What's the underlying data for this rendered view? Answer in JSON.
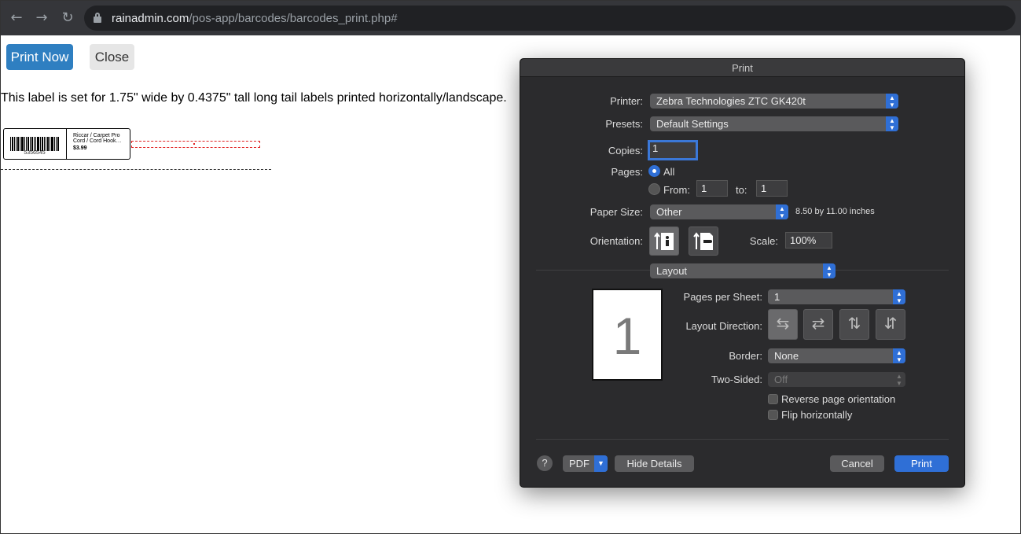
{
  "browser": {
    "back_glyph": "←",
    "forward_glyph": "→",
    "reload_glyph": "↻",
    "url_host": "rainadmin.com",
    "url_path": "/pos-app/barcodes/barcodes_print.php#"
  },
  "page": {
    "print_now_label": "Print Now",
    "close_label": "Close",
    "note": "This label is set for 1.75\" wide by 0.4375\" tall long tail labels printed horizontally/landscape.",
    "label": {
      "barcode_number": "5356545",
      "product_name": "Riccar / Carpet Pro Cord / Cord Hook…",
      "price": "$3.99"
    }
  },
  "dialog": {
    "title": "Print",
    "printer_label": "Printer:",
    "printer_value": "Zebra Technologies ZTC GK420t",
    "presets_label": "Presets:",
    "presets_value": "Default Settings",
    "copies_label": "Copies:",
    "copies_value": "1",
    "pages_label": "Pages:",
    "pages_all": "All",
    "pages_from": "From:",
    "pages_from_value": "1",
    "pages_to": "to:",
    "pages_to_value": "1",
    "paper_size_label": "Paper Size:",
    "paper_size_value": "Other",
    "paper_size_dims": "8.50 by 11.00 inches",
    "orientation_label": "Orientation:",
    "scale_label": "Scale:",
    "scale_value": "100%",
    "section_value": "Layout",
    "preview_page_number": "1",
    "pages_per_sheet_label": "Pages per Sheet:",
    "pages_per_sheet_value": "1",
    "layout_direction_label": "Layout Direction:",
    "border_label": "Border:",
    "border_value": "None",
    "two_sided_label": "Two-Sided:",
    "two_sided_value": "Off",
    "reverse_label": "Reverse page orientation",
    "flip_label": "Flip horizontally",
    "help_label": "?",
    "pdf_label": "PDF",
    "hide_details_label": "Hide Details",
    "cancel_label": "Cancel",
    "print_label": "Print",
    "accent_color": "#2f6fd6"
  }
}
